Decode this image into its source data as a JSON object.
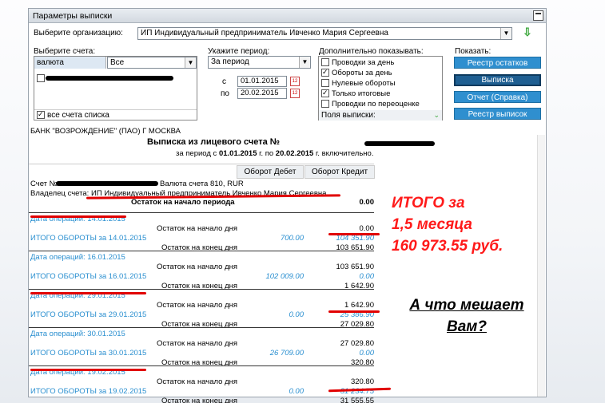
{
  "window": {
    "title": "Параметры выписки"
  },
  "form": {
    "org_label": "Выберите организацию:",
    "org_value": "ИП Индивидуальный предприниматель Ивченко Мария Сергеевна",
    "accounts_label": "Выберите счета:",
    "currency_col": "валюта",
    "currency_value": "Все",
    "all_accounts": "все счета списка",
    "period_label": "Укажите период:",
    "period_value": "За период",
    "from_label": "с",
    "from_date": "01.01.2015",
    "to_label": "по",
    "to_date": "20.02.2015",
    "extra_label": "Дополнительно показывать:",
    "options": [
      {
        "label": "Проводки за день",
        "checked": false
      },
      {
        "label": "Обороты за день",
        "checked": true
      },
      {
        "label": "Нулевые обороты",
        "checked": false
      },
      {
        "label": "Только итоговые",
        "checked": true
      },
      {
        "label": "Проводки по переоценке",
        "checked": false
      }
    ],
    "fields_label": "Поля выписки:",
    "show_label": "Показать:",
    "buttons": [
      "Реестр остатков",
      "Выписка",
      "Отчет (Справка)",
      "Реестр выписок"
    ],
    "calendar_icon_text": "12"
  },
  "statement": {
    "bank": "БАНК \"ВОЗРОЖДЕНИЕ\" (ПАО) Г МОСКВА",
    "title": "Выписка из лицевого счета №",
    "period_prefix": "за период с",
    "period_from": "01.01.2015",
    "period_mid": "г. по",
    "period_to": "20.02.2015",
    "period_suffix": "г. включительно.",
    "col_debit": "Оборот Дебет",
    "col_credit": "Оборот Кредит",
    "account_prefix": "Счет №",
    "account_suffix": "Валюта счета 810, RUR",
    "owner": "Владелец счета: ИП Индивидуальный предприниматель Ивченко Мария Сергеевна",
    "opening_label": "Остаток на начало периода",
    "opening_value": "0.00",
    "start_label": "Остаток на начало дня",
    "end_label": "Остаток на конец дня",
    "days": [
      {
        "date_label": "Дата операций: 14.01.2015",
        "start": "0.00",
        "total_label": "ИТОГО ОБОРОТЫ за 14.01.2015",
        "debit": "700.00",
        "credit": "104 351.90",
        "end": "103 651.90"
      },
      {
        "date_label": "Дата операций: 16.01.2015",
        "start": "103 651.90",
        "total_label": "ИТОГО ОБОРОТЫ за 16.01.2015",
        "debit": "102 009.00",
        "credit": "0.00",
        "end": "1 642.90"
      },
      {
        "date_label": "Дата операций: 29.01.2015",
        "start": "1 642.90",
        "total_label": "ИТОГО ОБОРОТЫ за 29.01.2015",
        "debit": "0.00",
        "credit": "25 386.90",
        "end": "27 029.80"
      },
      {
        "date_label": "Дата операций: 30.01.2015",
        "start": "27 029.80",
        "total_label": "ИТОГО ОБОРОТЫ за 30.01.2015",
        "debit": "26 709.00",
        "credit": "0.00",
        "end": "320.80"
      },
      {
        "date_label": "Дата операций: 19.02.2015",
        "start": "320.80",
        "total_label": "ИТОГО ОБОРОТЫ за 19.02.2015",
        "debit": "0.00",
        "credit": "31 234.75",
        "end": "31 555.55"
      }
    ]
  },
  "annotations": {
    "total_line1": "ИТОГО за",
    "total_line2": "1,5 месяца",
    "total_line3": "160 973.55 руб.",
    "question_line1": "А что мешает",
    "question_line2": "Вам?"
  },
  "colors": {
    "accent": "#2a8fd0",
    "button": "#2f8fcf",
    "annotation": "#ff1a1a"
  }
}
